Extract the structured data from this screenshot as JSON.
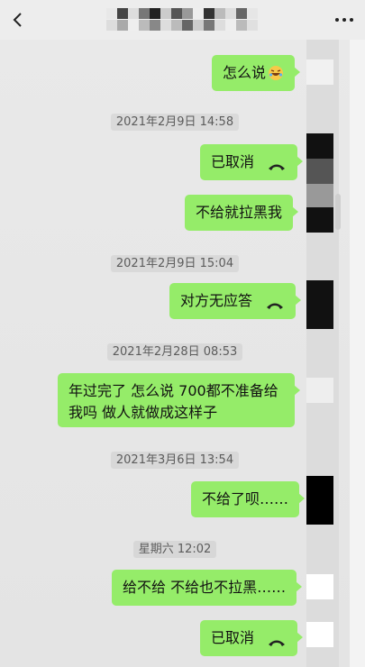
{
  "header": {
    "title_obscured": true,
    "back_icon": "chevron-left-icon",
    "more_icon": "ellipsis-icon"
  },
  "messages": [
    {
      "type": "bubble",
      "text": "怎么说",
      "emoji": "laughing-face-icon"
    },
    {
      "type": "time",
      "text": "2021年2月9日 14:58"
    },
    {
      "type": "call",
      "text": "已取消",
      "icon": "phone-hangup-icon"
    },
    {
      "type": "bubble",
      "text": "不给就拉黑我"
    },
    {
      "type": "time",
      "text": "2021年2月9日 15:04"
    },
    {
      "type": "call",
      "text": "对方无应答",
      "icon": "phone-hangup-icon"
    },
    {
      "type": "time",
      "text": "2021年2月28日 08:53"
    },
    {
      "type": "bubble",
      "lines": [
        "年过完了 怎么说 700都不准备给",
        "我吗 做人就做成这样子"
      ]
    },
    {
      "type": "time",
      "text": "2021年3月6日 13:54"
    },
    {
      "type": "bubble",
      "text": "不给了呗……"
    },
    {
      "type": "time",
      "text": "星期六 12:02"
    },
    {
      "type": "bubble",
      "text": "给不给 不给也不拉黑……"
    },
    {
      "type": "call",
      "text": "已取消",
      "icon": "phone-hangup-icon"
    }
  ],
  "colors": {
    "bubble": "#95ec69",
    "background": "#ececec",
    "timestamp_text": "#5b5b5b"
  }
}
